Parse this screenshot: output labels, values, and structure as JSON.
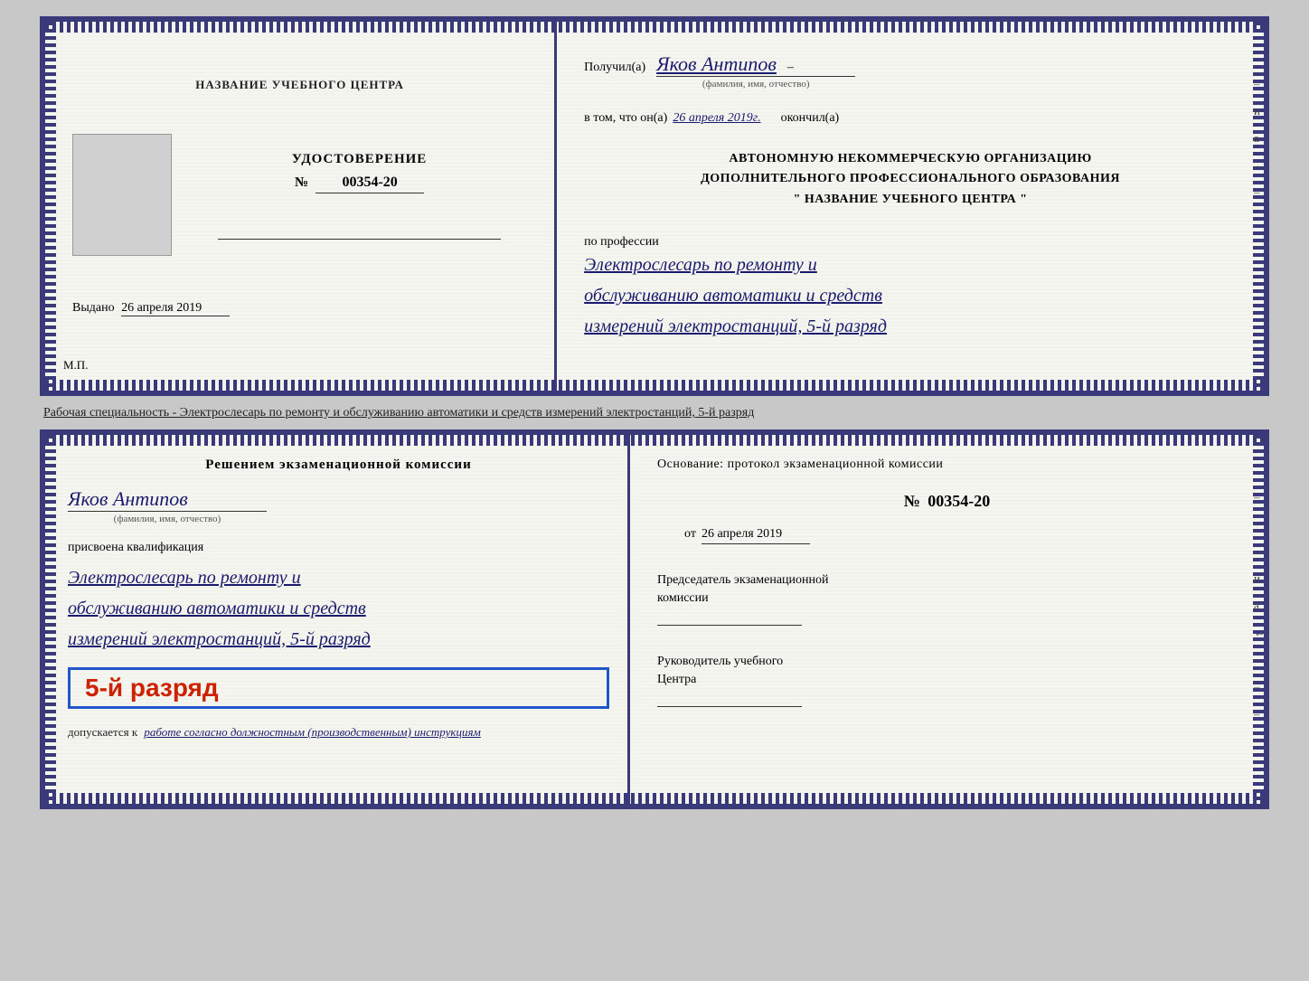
{
  "topDoc": {
    "left": {
      "centerLabel": "НАЗВАНИЕ УЧЕБНОГО ЦЕНТРА",
      "certTitle": "УДОСТОВЕРЕНИЕ",
      "certNumLabel": "№",
      "certNum": "00354-20",
      "issuedLabel": "Выдано",
      "issuedDate": "26 апреля 2019",
      "mpLabel": "М.П."
    },
    "right": {
      "recipientPrefix": "Получил(а)",
      "recipientName": "Яков Антипов",
      "fioLabel": "(фамилия, имя, отчество)",
      "givenPrefix": "в том, что он(а)",
      "givenDate": "26 апреля 2019г.",
      "givenSuffix": "окончил(а)",
      "orgLine1": "АВТОНОМНУЮ НЕКОММЕРЧЕСКУЮ ОРГАНИЗАЦИЮ",
      "orgLine2": "ДОПОЛНИТЕЛЬНОГО ПРОФЕССИОНАЛЬНОГО ОБРАЗОВАНИЯ",
      "orgLine3": "\"    НАЗВАНИЕ УЧЕБНОГО ЦЕНТРА    \"",
      "professionLabel": "по профессии",
      "professionLine1": "Электрослесарь по ремонту и",
      "professionLine2": "обслуживанию автоматики и средств",
      "professionLine3": "измерений электростанций, 5-й разряд"
    }
  },
  "middleInfo": {
    "text": "Рабочая специальность - Электрослесарь по ремонту и обслуживанию автоматики и средств измерений электростанций, 5-й разряд"
  },
  "bottomDoc": {
    "left": {
      "decisionLine1": "Решением экзаменационной комиссии",
      "personName": "Яков Антипов",
      "fioLabel": "(фамилия, имя, отчество)",
      "qualificationLabel": "присвоена квалификация",
      "qualLine1": "Электрослесарь по ремонту и",
      "qualLine2": "обслуживанию автоматики и средств",
      "qualLine3": "измерений электростанций, 5-й разряд",
      "gradeText": "5-й разряд",
      "допускаетсяPrefix": "допускается к",
      "допускаетсяHw": "работе согласно должностным (производственным) инструкциям"
    },
    "right": {
      "basisLabel": "Основание: протокол экзаменационной комиссии",
      "protocolNumLabel": "№",
      "protocolNum": "00354-20",
      "fromLabel": "от",
      "fromDate": "26 апреля 2019",
      "chairmanTitle1": "Председатель экзаменационной",
      "chairmanTitle2": "комиссии",
      "directorTitle1": "Руководитель учебного",
      "directorTitle2": "Центра"
    }
  }
}
